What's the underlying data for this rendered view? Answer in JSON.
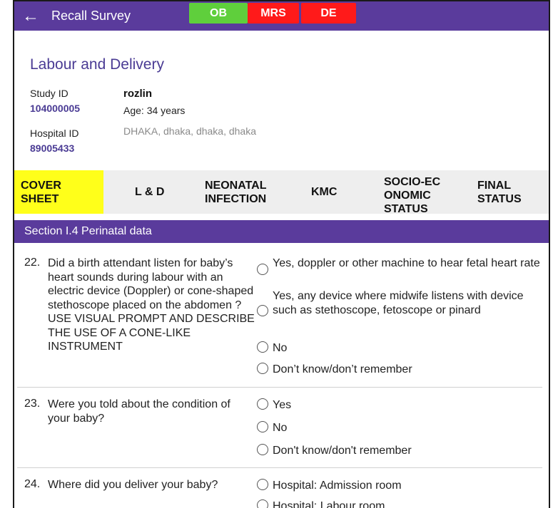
{
  "app_bar": {
    "back": "←",
    "title": "Recall Survey"
  },
  "badges": {
    "ob": "OB",
    "mrs": "MRS",
    "de": "DE"
  },
  "heading": "Labour and Delivery",
  "patient": {
    "study_id_label": "Study ID",
    "study_id": "104000005",
    "hospital_id_label": "Hospital ID",
    "hospital_id": "89005433",
    "name": "rozlin",
    "age": "Age: 34 years",
    "address": "DHAKA, dhaka, dhaka, dhaka"
  },
  "tabs": [
    {
      "label_line1": "COVER",
      "label_line2": "SHEET",
      "label_line3": ""
    },
    {
      "label_line1": "L & D",
      "label_line2": "",
      "label_line3": ""
    },
    {
      "label_line1": "NEONATAL",
      "label_line2": "INFECTION",
      "label_line3": ""
    },
    {
      "label_line1": "KMC",
      "label_line2": "",
      "label_line3": ""
    },
    {
      "label_line1": "SOCIO-EC",
      "label_line2": "ONOMIC",
      "label_line3": "STATUS"
    },
    {
      "label_line1": "FINAL",
      "label_line2": "STATUS",
      "label_line3": ""
    }
  ],
  "section_title": "Section I.4 Perinatal data",
  "questions": [
    {
      "number": "22.",
      "text": "Did a birth attendant listen for baby’s heart sounds during labour with an electric device (Doppler) or cone-shaped stethoscope placed on the abdomen ? USE VISUAL PROMPT AND  DESCRIBE THE USE OF A CONE-LIKE INSTRUMENT",
      "options": [
        "Yes, doppler or other machine to hear fetal heart rate",
        "Yes, any device where midwife listens with device such as stethoscope, fetoscope or pinard",
        "No",
        "Don’t know/don’t remember"
      ]
    },
    {
      "number": "23.",
      "text": "Were you told about the condition of your baby?",
      "options": [
        "Yes",
        "No",
        "Don't know/don't remember"
      ]
    },
    {
      "number": "24.",
      "text": "Where did you deliver your baby?",
      "options": [
        "Hospital: Admission room",
        "Hospital: Labour room"
      ]
    }
  ],
  "colors": {
    "primary": "#5a3b9c",
    "ob_badge": "#5fcf3c",
    "alert_badge": "#ff1a1a",
    "active_tab": "#ffff1a"
  }
}
